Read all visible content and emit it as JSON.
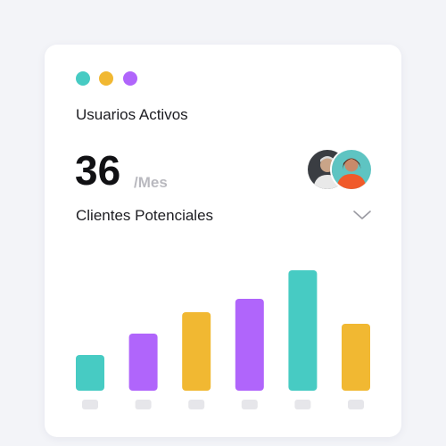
{
  "window": {
    "dot_colors": [
      "#47cbc3",
      "#f1b832",
      "#b065fb"
    ]
  },
  "card": {
    "title": "Usuarios Activos",
    "metric_value": "36",
    "metric_unit": "/Mes",
    "avatars": [
      {
        "name": "avatar-1-icon"
      },
      {
        "name": "avatar-2-icon"
      }
    ],
    "dropdown": {
      "selected": "Clientes Potenciales",
      "icon": "chevron-down-icon"
    }
  },
  "colors": {
    "teal": "#47cbc3",
    "purple": "#b065fb",
    "yellow": "#f1b832",
    "axis_pill": "#e6e6ea"
  },
  "chart_data": {
    "type": "bar",
    "categories": [
      "",
      "",
      "",
      "",
      "",
      ""
    ],
    "values": [
      40,
      64,
      88,
      103,
      135,
      75
    ],
    "ylim": [
      0,
      140
    ],
    "colors": [
      "#47cbc3",
      "#b065fb",
      "#f1b832",
      "#b065fb",
      "#47cbc3",
      "#f1b832"
    ],
    "grid": false,
    "legend": "none"
  }
}
